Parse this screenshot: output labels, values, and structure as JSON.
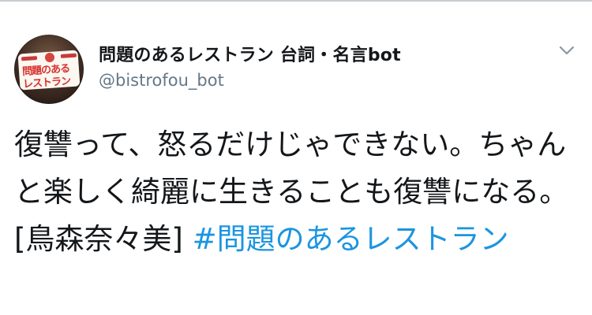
{
  "tweet": {
    "author": {
      "display_name": "問題のあるレストラン 台詞・名言bot",
      "handle": "@bistrofou_bot",
      "avatar": {
        "logo_line1": "問題のある",
        "logo_line2": "レストラン"
      }
    },
    "menu_icon": "chevron-down-icon",
    "body": {
      "text": "復讐って、怒るだけじゃできない。ちゃんと楽しく綺麗に生きることも復讐になる。 [鳥森奈々美] ",
      "hashtag": "#問題のあるレストラン"
    }
  },
  "colors": {
    "text_primary": "#14171a",
    "text_secondary": "#657786",
    "link": "#1b95e0",
    "chevron": "#8899a6",
    "divider": "#c8cdd1",
    "logo_red": "#d8322e"
  }
}
